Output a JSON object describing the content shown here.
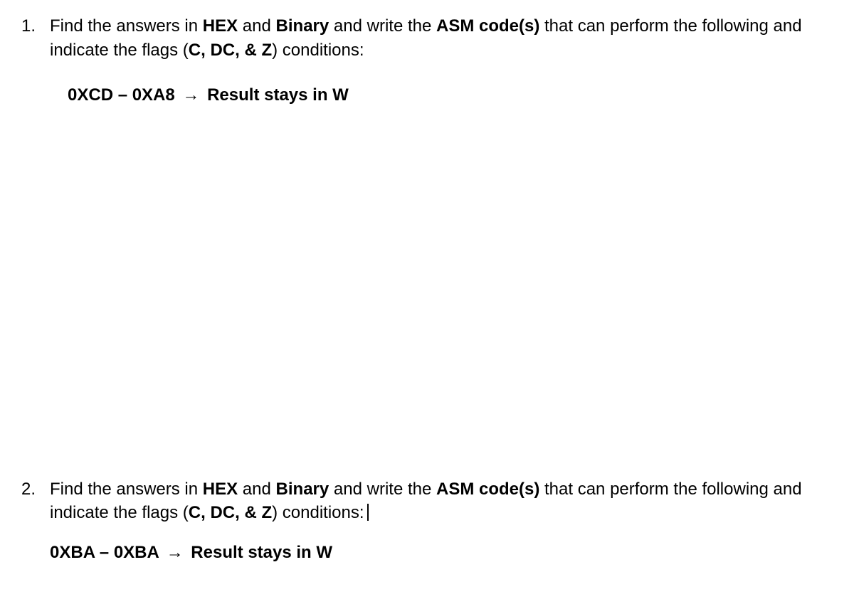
{
  "q1": {
    "number": "1.",
    "text_pre": "Find the answers in ",
    "hex": "HEX",
    "and1": " and ",
    "binary": "Binary",
    "write_pre": " and write the ",
    "asm": "ASM code(s)",
    "text_mid": " that can perform the following and indicate the flags (",
    "flags": "C, DC, & Z",
    "text_post": ") conditions:",
    "sub_left": "0XCD – 0XA8",
    "arrow": "→",
    "sub_right": "Result stays in W"
  },
  "q2": {
    "number": "2.",
    "text_pre": "Find the answers in ",
    "hex": "HEX",
    "and1": " and ",
    "binary": "Binary",
    "write_pre": " and write the ",
    "asm": "ASM code(s)",
    "text_mid": " that can perform the following and indicate the flags (",
    "flags": "C, DC, & Z",
    "text_post": ") conditions:",
    "sub_left": "0XBA – 0XBA",
    "arrow": "→",
    "sub_right": "Result stays in W"
  }
}
